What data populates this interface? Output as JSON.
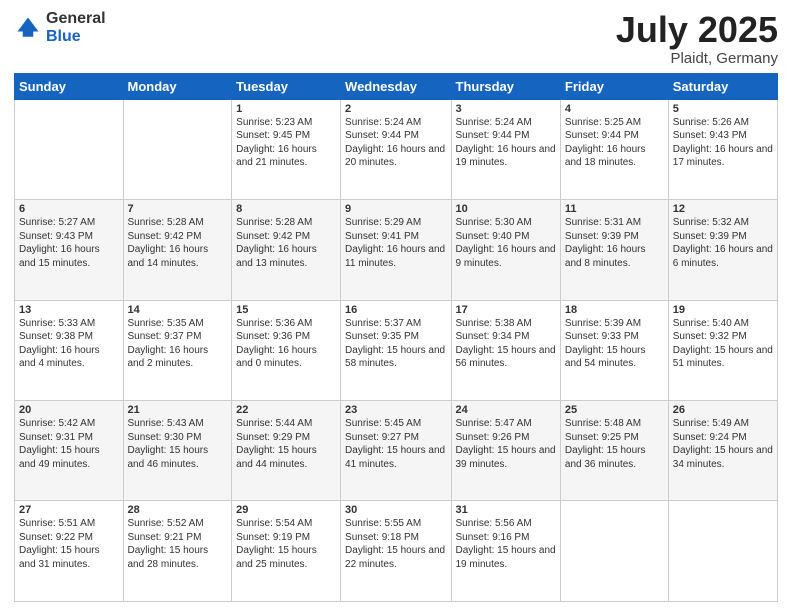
{
  "logo": {
    "general": "General",
    "blue": "Blue"
  },
  "header": {
    "month": "July 2025",
    "location": "Plaidt, Germany"
  },
  "weekdays": [
    "Sunday",
    "Monday",
    "Tuesday",
    "Wednesday",
    "Thursday",
    "Friday",
    "Saturday"
  ],
  "weeks": [
    [
      {
        "day": "",
        "info": ""
      },
      {
        "day": "",
        "info": ""
      },
      {
        "day": "1",
        "info": "Sunrise: 5:23 AM\nSunset: 9:45 PM\nDaylight: 16 hours and 21 minutes."
      },
      {
        "day": "2",
        "info": "Sunrise: 5:24 AM\nSunset: 9:44 PM\nDaylight: 16 hours and 20 minutes."
      },
      {
        "day": "3",
        "info": "Sunrise: 5:24 AM\nSunset: 9:44 PM\nDaylight: 16 hours and 19 minutes."
      },
      {
        "day": "4",
        "info": "Sunrise: 5:25 AM\nSunset: 9:44 PM\nDaylight: 16 hours and 18 minutes."
      },
      {
        "day": "5",
        "info": "Sunrise: 5:26 AM\nSunset: 9:43 PM\nDaylight: 16 hours and 17 minutes."
      }
    ],
    [
      {
        "day": "6",
        "info": "Sunrise: 5:27 AM\nSunset: 9:43 PM\nDaylight: 16 hours and 15 minutes."
      },
      {
        "day": "7",
        "info": "Sunrise: 5:28 AM\nSunset: 9:42 PM\nDaylight: 16 hours and 14 minutes."
      },
      {
        "day": "8",
        "info": "Sunrise: 5:28 AM\nSunset: 9:42 PM\nDaylight: 16 hours and 13 minutes."
      },
      {
        "day": "9",
        "info": "Sunrise: 5:29 AM\nSunset: 9:41 PM\nDaylight: 16 hours and 11 minutes."
      },
      {
        "day": "10",
        "info": "Sunrise: 5:30 AM\nSunset: 9:40 PM\nDaylight: 16 hours and 9 minutes."
      },
      {
        "day": "11",
        "info": "Sunrise: 5:31 AM\nSunset: 9:39 PM\nDaylight: 16 hours and 8 minutes."
      },
      {
        "day": "12",
        "info": "Sunrise: 5:32 AM\nSunset: 9:39 PM\nDaylight: 16 hours and 6 minutes."
      }
    ],
    [
      {
        "day": "13",
        "info": "Sunrise: 5:33 AM\nSunset: 9:38 PM\nDaylight: 16 hours and 4 minutes."
      },
      {
        "day": "14",
        "info": "Sunrise: 5:35 AM\nSunset: 9:37 PM\nDaylight: 16 hours and 2 minutes."
      },
      {
        "day": "15",
        "info": "Sunrise: 5:36 AM\nSunset: 9:36 PM\nDaylight: 16 hours and 0 minutes."
      },
      {
        "day": "16",
        "info": "Sunrise: 5:37 AM\nSunset: 9:35 PM\nDaylight: 15 hours and 58 minutes."
      },
      {
        "day": "17",
        "info": "Sunrise: 5:38 AM\nSunset: 9:34 PM\nDaylight: 15 hours and 56 minutes."
      },
      {
        "day": "18",
        "info": "Sunrise: 5:39 AM\nSunset: 9:33 PM\nDaylight: 15 hours and 54 minutes."
      },
      {
        "day": "19",
        "info": "Sunrise: 5:40 AM\nSunset: 9:32 PM\nDaylight: 15 hours and 51 minutes."
      }
    ],
    [
      {
        "day": "20",
        "info": "Sunrise: 5:42 AM\nSunset: 9:31 PM\nDaylight: 15 hours and 49 minutes."
      },
      {
        "day": "21",
        "info": "Sunrise: 5:43 AM\nSunset: 9:30 PM\nDaylight: 15 hours and 46 minutes."
      },
      {
        "day": "22",
        "info": "Sunrise: 5:44 AM\nSunset: 9:29 PM\nDaylight: 15 hours and 44 minutes."
      },
      {
        "day": "23",
        "info": "Sunrise: 5:45 AM\nSunset: 9:27 PM\nDaylight: 15 hours and 41 minutes."
      },
      {
        "day": "24",
        "info": "Sunrise: 5:47 AM\nSunset: 9:26 PM\nDaylight: 15 hours and 39 minutes."
      },
      {
        "day": "25",
        "info": "Sunrise: 5:48 AM\nSunset: 9:25 PM\nDaylight: 15 hours and 36 minutes."
      },
      {
        "day": "26",
        "info": "Sunrise: 5:49 AM\nSunset: 9:24 PM\nDaylight: 15 hours and 34 minutes."
      }
    ],
    [
      {
        "day": "27",
        "info": "Sunrise: 5:51 AM\nSunset: 9:22 PM\nDaylight: 15 hours and 31 minutes."
      },
      {
        "day": "28",
        "info": "Sunrise: 5:52 AM\nSunset: 9:21 PM\nDaylight: 15 hours and 28 minutes."
      },
      {
        "day": "29",
        "info": "Sunrise: 5:54 AM\nSunset: 9:19 PM\nDaylight: 15 hours and 25 minutes."
      },
      {
        "day": "30",
        "info": "Sunrise: 5:55 AM\nSunset: 9:18 PM\nDaylight: 15 hours and 22 minutes."
      },
      {
        "day": "31",
        "info": "Sunrise: 5:56 AM\nSunset: 9:16 PM\nDaylight: 15 hours and 19 minutes."
      },
      {
        "day": "",
        "info": ""
      },
      {
        "day": "",
        "info": ""
      }
    ]
  ]
}
